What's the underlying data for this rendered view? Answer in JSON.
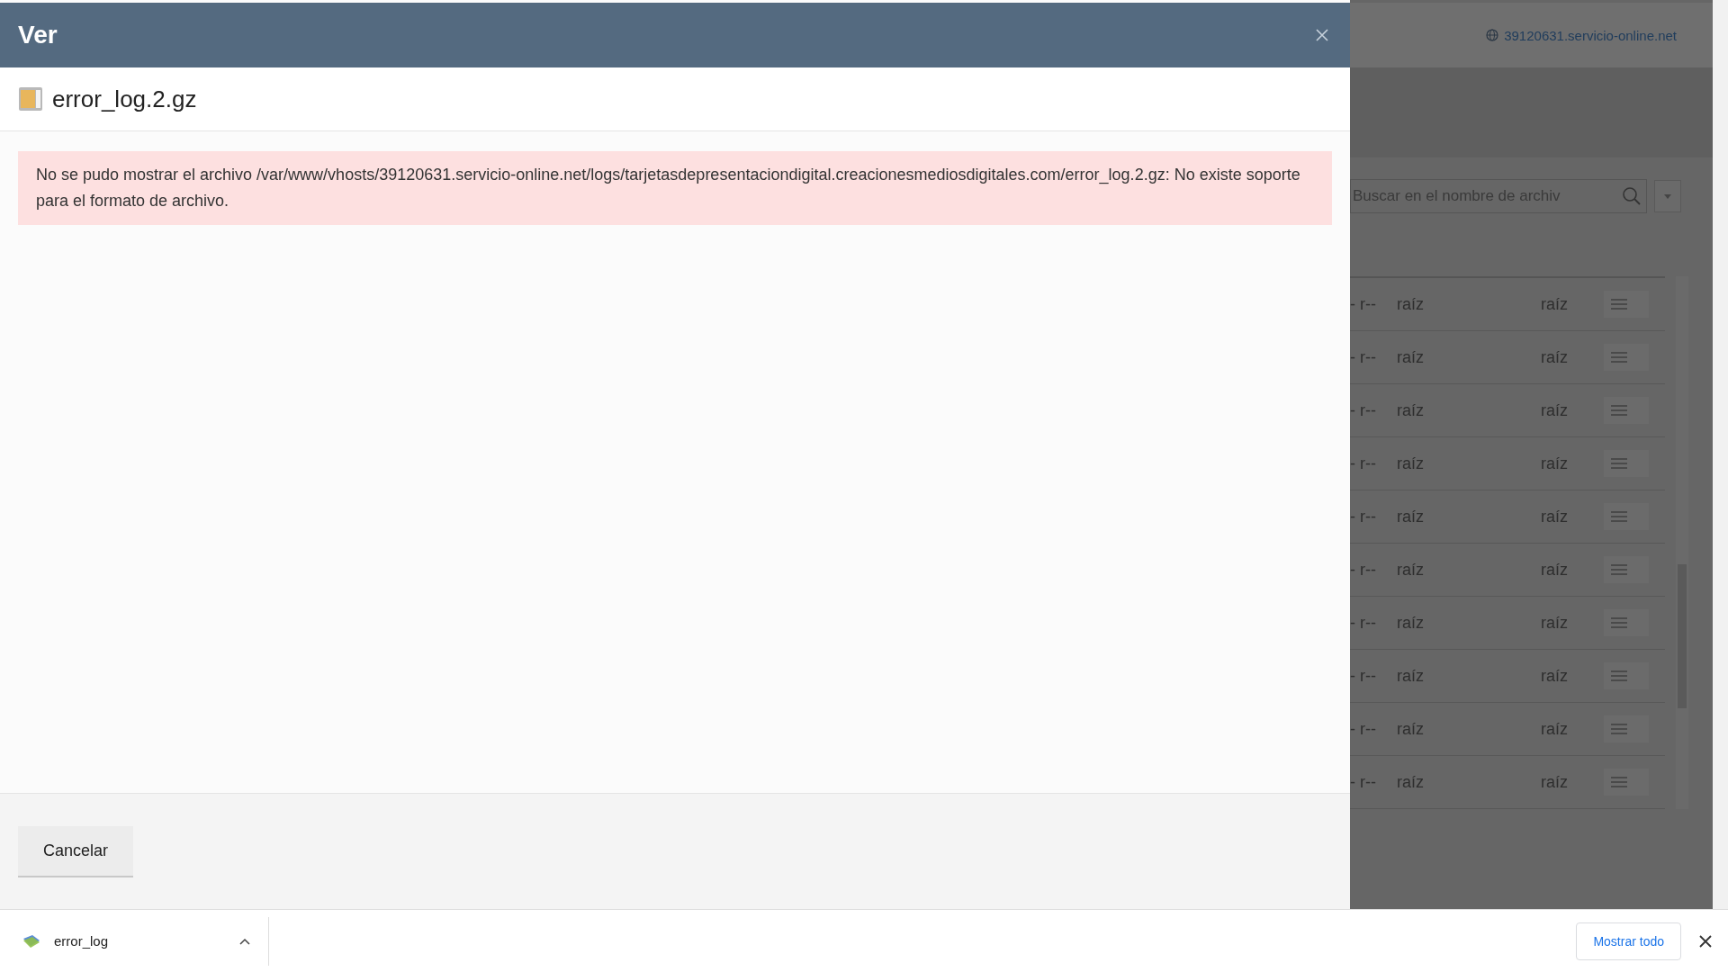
{
  "dialog": {
    "title": "Ver",
    "file_name": "error_log.2.gz",
    "error_message": "No se pudo mostrar el archivo /var/www/vhosts/39120631.servicio-online.net/logs/tarjetasdepresentaciondigital.creacionesmediosdigitales.com/error_log.2.gz: No existe soporte para el formato de archivo.",
    "cancel_button": "Cancelar"
  },
  "background": {
    "domain": "39120631.servicio-online.net",
    "search": {
      "placeholder": "Buscar en el nombre de archiv"
    },
    "rows": [
      {
        "permissions": "- r--",
        "owner": "raíz",
        "group": "raíz"
      },
      {
        "permissions": "- r--",
        "owner": "raíz",
        "group": "raíz"
      },
      {
        "permissions": "- r--",
        "owner": "raíz",
        "group": "raíz"
      },
      {
        "permissions": "- r--",
        "owner": "raíz",
        "group": "raíz"
      },
      {
        "permissions": "- r--",
        "owner": "raíz",
        "group": "raíz"
      },
      {
        "permissions": "- r--",
        "owner": "raíz",
        "group": "raíz"
      },
      {
        "permissions": "- r--",
        "owner": "raíz",
        "group": "raíz"
      },
      {
        "permissions": "- r--",
        "owner": "raíz",
        "group": "raíz"
      },
      {
        "permissions": "- r--",
        "owner": "raíz",
        "group": "raíz"
      },
      {
        "permissions": "- r--",
        "owner": "raíz",
        "group": "raíz"
      }
    ]
  },
  "download_bar": {
    "file": "error_log",
    "show_all_button": "Mostrar todo"
  }
}
